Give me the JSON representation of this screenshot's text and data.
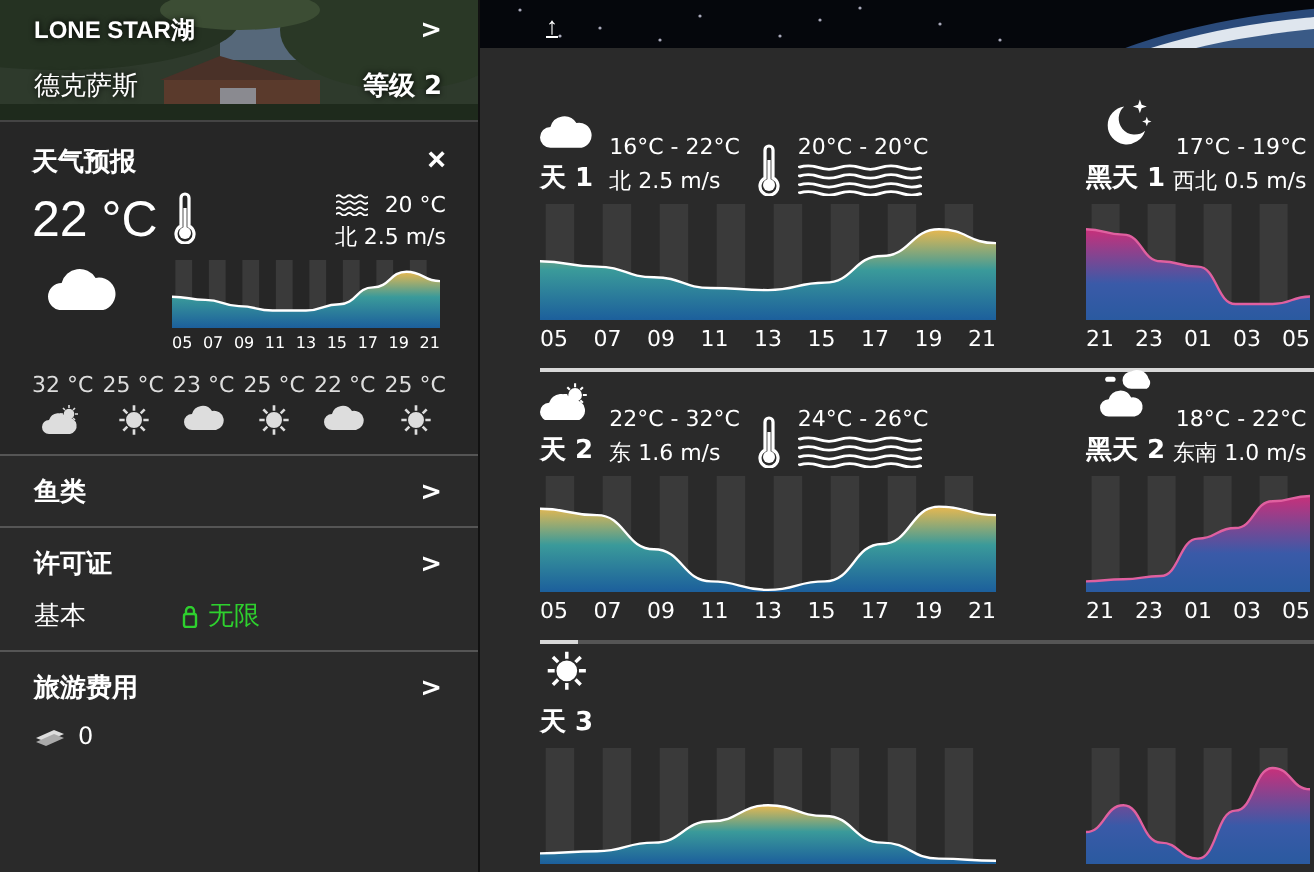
{
  "location": {
    "title": "LONE STAR湖",
    "chevron": ">",
    "region": "德克萨斯",
    "level_label": "等级 2"
  },
  "weather": {
    "title": "天气预报",
    "close": "×",
    "temperature": "22 °C",
    "kind": "cloud",
    "water_temp": "20 °C",
    "wind": "北 2.5 m/s",
    "hours": [
      "05",
      "07",
      "09",
      "11",
      "13",
      "15",
      "17",
      "19",
      "21"
    ],
    "forecast": [
      {
        "temp": "32 °C",
        "kind": "partly-sunny"
      },
      {
        "temp": "25 °C",
        "kind": "sun"
      },
      {
        "temp": "23 °C",
        "kind": "cloud"
      },
      {
        "temp": "25 °C",
        "kind": "sun"
      },
      {
        "temp": "22 °C",
        "kind": "cloud"
      },
      {
        "temp": "25 °C",
        "kind": "sun"
      }
    ]
  },
  "sections": [
    {
      "title": "鱼类",
      "chevron": ">"
    },
    {
      "title": "许可证",
      "chevron": ">",
      "kind": "license",
      "detail_label": "基本",
      "detail_value": "无限"
    },
    {
      "title": "旅游费用",
      "chevron": ">",
      "kind": "money",
      "detail_value": "0"
    }
  ],
  "top_bar": {
    "arrow": "↑"
  },
  "rows": [
    {
      "level": 1,
      "day": {
        "kind": "cloud",
        "label": "天 1",
        "air": "16°C - 22°C",
        "wind": "北 2.5 m/s",
        "water": "20°C - 20°C",
        "hours": [
          "05",
          "07",
          "09",
          "11",
          "13",
          "15",
          "17",
          "19",
          "21"
        ]
      },
      "night": {
        "kind": "moon",
        "label": "黑天 1",
        "air": "17°C - 19°C",
        "wind": "西北 0.5 m/s",
        "hours": [
          "21",
          "23",
          "01",
          "03",
          "05"
        ]
      }
    },
    {
      "level": 0.05,
      "day": {
        "kind": "partly-sunny",
        "label": "天 2",
        "air": "22°C - 32°C",
        "wind": "东 1.6 m/s",
        "water": "24°C - 26°C",
        "hours": [
          "05",
          "07",
          "09",
          "11",
          "13",
          "15",
          "17",
          "19",
          "21"
        ]
      },
      "night": {
        "kind": "night-cloud",
        "label": "黑天 2",
        "air": "18°C - 22°C",
        "wind": "东南 1.0 m/s",
        "hours": [
          "21",
          "23",
          "01",
          "03",
          "05"
        ]
      }
    },
    {
      "day": {
        "kind": "sun",
        "label": "天 3"
      },
      "night": {}
    }
  ]
}
